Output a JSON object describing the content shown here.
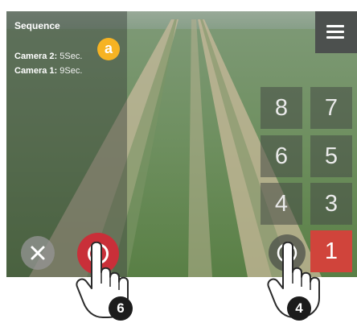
{
  "sidebar": {
    "title": "Sequence",
    "cameras": [
      {
        "label": "Camera 2:",
        "value": "5Sec."
      },
      {
        "label": "Camera 1:",
        "value": "9Sec."
      }
    ]
  },
  "badge": {
    "letter": "a",
    "color": "#f6b323"
  },
  "menu": {
    "icon": "hamburger-menu-icon"
  },
  "keypad": {
    "keys": [
      "8",
      "7",
      "6",
      "5",
      "4",
      "3",
      "1"
    ]
  },
  "controls": {
    "close_icon": "close-icon",
    "record_icon": "record-icon",
    "play_icon": "play-icon"
  },
  "steps": [
    "6",
    "4"
  ],
  "colors": {
    "accent": "#f6b323",
    "record": "#c92f39",
    "key_active": "#d0443b"
  }
}
